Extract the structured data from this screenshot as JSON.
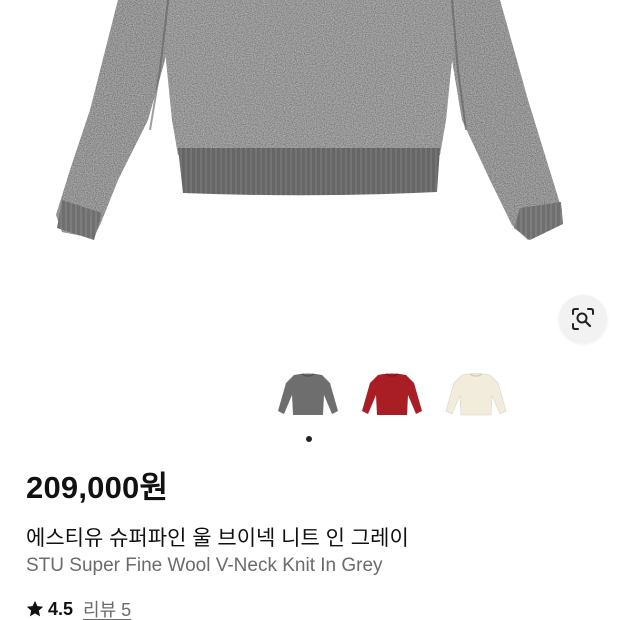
{
  "product": {
    "price": "209,000원",
    "name_ko": "에스티유 슈퍼파인 울 브이넥 니트 인 그레이",
    "name_en": "STU Super Fine Wool V-Neck Knit In Grey",
    "rating": "4.5",
    "review_link": "리뷰 5",
    "rating_icon": "star-icon"
  },
  "gallery": {
    "main_image": "grey-knit-sweater",
    "lens_icon": "visual-search-icon",
    "thumbnails": [
      {
        "name": "grey",
        "color": "#6e6e6e"
      },
      {
        "name": "red",
        "color": "#a81e24"
      },
      {
        "name": "cream",
        "color": "#f2ecdd"
      }
    ],
    "active_page": 1
  },
  "colors": {
    "sweater_grey": "#737373",
    "text_primary": "#111111",
    "text_secondary": "#6b6b6b"
  }
}
